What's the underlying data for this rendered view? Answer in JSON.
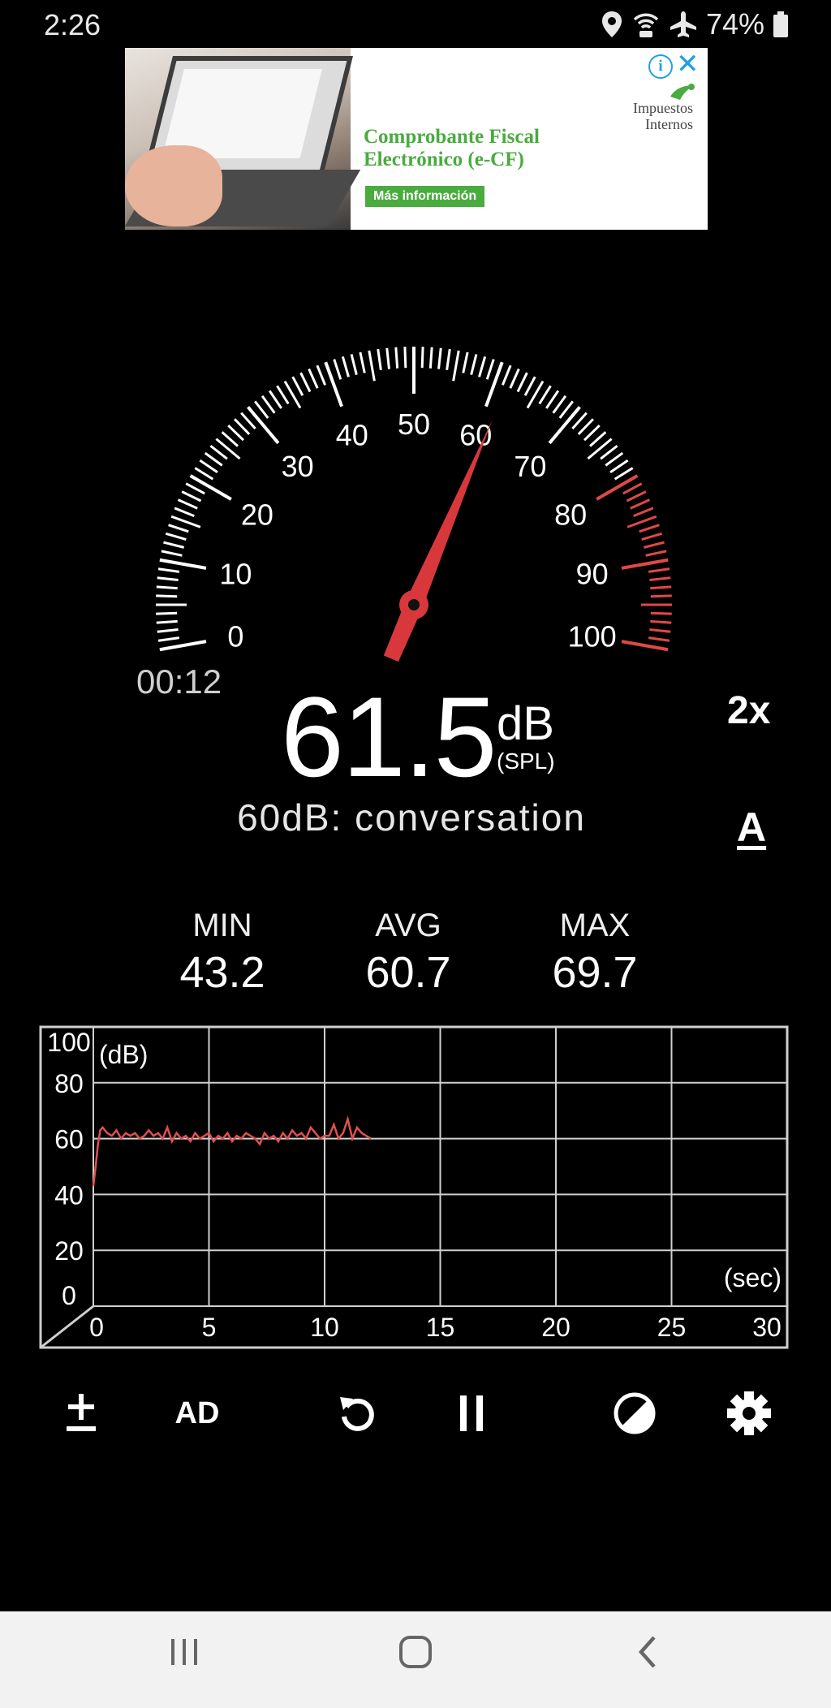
{
  "status_bar": {
    "time": "2:26",
    "battery": "74%",
    "icons": [
      "location-icon",
      "wifi-calling-icon",
      "airplane-icon",
      "battery-icon"
    ]
  },
  "ad": {
    "headline_line1": "Comprobante Fiscal",
    "headline_line2": "Electrónico (e-CF)",
    "cta": "Más información",
    "brand_line1": "Impuestos",
    "brand_line2": "Internos",
    "info_glyph": "i",
    "close_glyph": "✕"
  },
  "meter": {
    "scale_labels": [
      "0",
      "10",
      "20",
      "30",
      "40",
      "50",
      "60",
      "70",
      "80",
      "90",
      "100"
    ],
    "needle_value": 61.5,
    "elapsed": "00:12",
    "reading": "61.5",
    "unit": "dB",
    "unit_sub": "(SPL)",
    "level_description": "60dB: conversation",
    "zoom_label": "2x",
    "weighting_label": "A",
    "red_zone_start": 80
  },
  "stats": {
    "min_label": "MIN",
    "min_value": "43.2",
    "avg_label": "AVG",
    "avg_value": "60.7",
    "max_label": "MAX",
    "max_value": "69.7"
  },
  "chart_data": {
    "type": "line",
    "ylabel": "(dB)",
    "xlabel": "(sec)",
    "xlim": [
      0,
      30
    ],
    "ylim": [
      0,
      100
    ],
    "x_ticks": [
      0,
      5,
      10,
      15,
      20,
      25,
      30
    ],
    "y_ticks": [
      0,
      20,
      40,
      60,
      80,
      100
    ],
    "grid": true,
    "color": "#e05050",
    "series": [
      {
        "x": [
          0.0,
          0.1,
          0.2,
          0.3,
          0.4,
          0.6,
          0.8,
          1.0,
          1.2,
          1.4,
          1.6,
          1.8,
          2.0,
          2.2,
          2.4,
          2.6,
          2.8,
          3.0,
          3.2,
          3.4,
          3.6,
          3.8,
          4.0,
          4.2,
          4.4,
          4.6,
          4.8,
          5.0,
          5.2,
          5.4,
          5.6,
          5.8,
          6.0,
          6.2,
          6.4,
          6.6,
          6.8,
          7.0,
          7.2,
          7.4,
          7.6,
          7.8,
          8.0,
          8.2,
          8.4,
          8.6,
          8.8,
          9.0,
          9.2,
          9.4,
          9.6,
          9.8,
          10.0,
          10.2,
          10.4,
          10.6,
          10.8,
          11.0,
          11.2,
          11.4,
          11.6,
          11.8,
          12.0
        ],
        "y": [
          43,
          50,
          58,
          63,
          64,
          62,
          61,
          63,
          60,
          62,
          61,
          62,
          60,
          61,
          63,
          61,
          62,
          60,
          64,
          59,
          62,
          60,
          61,
          59,
          62,
          60,
          61,
          62,
          59,
          61,
          60,
          62,
          59,
          61,
          60,
          62,
          61,
          60,
          58,
          62,
          60,
          61,
          59,
          62,
          60,
          63,
          61,
          62,
          60,
          64,
          62,
          60,
          61,
          61,
          65,
          60,
          62,
          67,
          60,
          64,
          62,
          61,
          60
        ]
      }
    ]
  },
  "toolbar": {
    "calibrate_icon": "plus-minus-icon",
    "ad_label": "AD",
    "reset_icon": "reset-icon",
    "pause_icon": "pause-icon",
    "theme_icon": "contrast-icon",
    "settings_icon": "gear-icon"
  },
  "nav": {
    "icons": [
      "recent-apps-icon",
      "home-icon",
      "back-icon"
    ]
  }
}
